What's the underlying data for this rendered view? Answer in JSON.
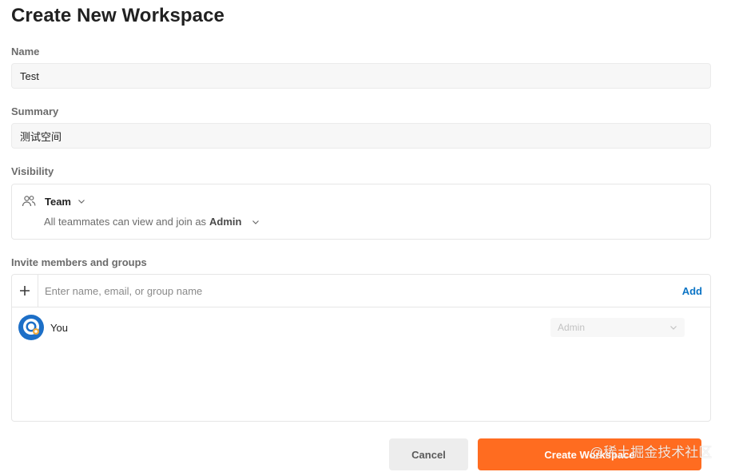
{
  "page": {
    "title": "Create New Workspace"
  },
  "name": {
    "label": "Name",
    "value": "Test"
  },
  "summary": {
    "label": "Summary",
    "value": "测试空间"
  },
  "visibility": {
    "label": "Visibility",
    "type": "Team",
    "type_icon": "team-icon",
    "description": "All teammates can view and join as",
    "role": "Admin"
  },
  "invite": {
    "label": "Invite members and groups",
    "placeholder": "Enter name, email, or group name",
    "add_label": "Add",
    "members": [
      {
        "name": "You",
        "role": "Admin"
      }
    ]
  },
  "actions": {
    "cancel_label": "Cancel",
    "create_label": "Create Workspace"
  },
  "watermark": "@稀土掘金技术社区",
  "colors": {
    "accent": "#ff6c20",
    "link": "#0b74c5",
    "field_bg": "#f7f7f7",
    "border": "#e6e6e6"
  }
}
